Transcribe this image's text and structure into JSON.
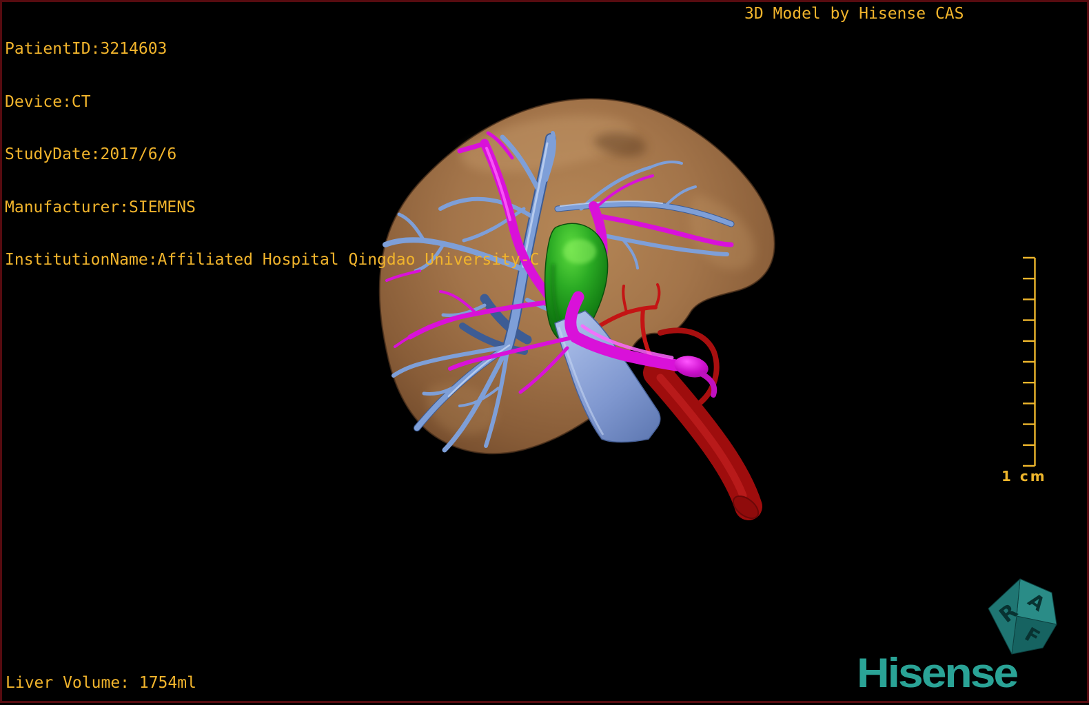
{
  "header": {
    "patient_lines": [
      "PatientID:3214603",
      "Device:CT",
      "StudyDate:2017/6/6",
      "Manufacturer:SIEMENS",
      "InstitutionName:Affiliated Hospital Qingdao University-C"
    ],
    "watermark": "3D Model by Hisense CAS"
  },
  "footer": {
    "liver_volume": "Liver Volume: 1754ml"
  },
  "scale_bar": {
    "label": "1 cm",
    "tick_count": 11,
    "divisions": 10,
    "color": "#eeb62c"
  },
  "orientation_cube": {
    "faces": [
      {
        "letter": "R",
        "position": "left"
      },
      {
        "letter": "A",
        "position": "upper-right"
      },
      {
        "letter": "F",
        "position": "lower-right"
      }
    ],
    "color": "#1f7e7b"
  },
  "branding": {
    "logo_text": "Hisense",
    "color": "#2aa396"
  },
  "model": {
    "description": "3D segmented liver model",
    "background": "#000000",
    "frame_color": "#570b10",
    "text_color": "#f1b42c",
    "structures": [
      {
        "name": "liver",
        "color": "#a5764a",
        "style": "semi-transparent"
      },
      {
        "name": "hepatic-veins",
        "color": "#7e9fd8"
      },
      {
        "name": "portal-vein",
        "color": "#d911d9"
      },
      {
        "name": "hepatic-artery",
        "color": "#b01010"
      },
      {
        "name": "gallbladder",
        "color": "#1d8f18"
      },
      {
        "name": "bile-duct",
        "color": "#93abe2"
      }
    ]
  }
}
